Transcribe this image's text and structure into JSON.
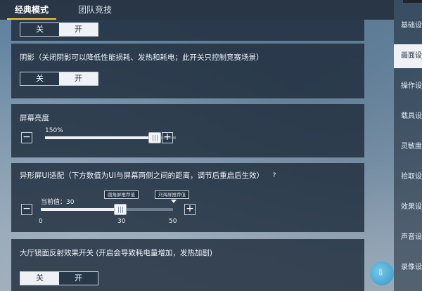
{
  "tabs": [
    "经典模式",
    "团队竞技"
  ],
  "active_tab": 0,
  "top_toggle": {
    "off": "关",
    "on": "开",
    "selected": "on"
  },
  "shadow": {
    "title": "阴影（关闭阴影可以降低性能损耗、发热和耗电；此开关只控制竞赛场景）",
    "off": "关",
    "on": "开",
    "selected": "on"
  },
  "brightness": {
    "title": "屏幕亮度",
    "value_label": "150%",
    "level": 0.84,
    "minus": "−",
    "plus": "+"
  },
  "notch": {
    "title": "异形屏UI适配（下方数值为UI与屏幕两侧之间的距离，调节后重启后生效）",
    "help": "?",
    "current_label": "当前值：30",
    "value": 30,
    "min": 0,
    "max": 50,
    "ticks": [
      "0",
      "30",
      "50"
    ],
    "marker_rounded": "圆角屏推荐值",
    "marker_notch": "刘海屏推荐值",
    "minus": "−",
    "plus": "+"
  },
  "reflection": {
    "title": "大厅镜面反射效果开关 (开启会导致耗电量增加，发热加剧)",
    "off": "关",
    "on": "开",
    "selected": "off"
  },
  "sidebar": {
    "items": [
      "基础设",
      "画面设",
      "操作设",
      "载具设",
      "灵敏度设",
      "拾取设",
      "效果设",
      "声音设",
      "录像设"
    ],
    "active": 1
  },
  "colors": {
    "accent": "#f2c94c",
    "panel": "#1e2c3c",
    "selected": "#eef2f6"
  },
  "icons": {
    "help": "question-icon",
    "minus": "minus-icon",
    "plus": "plus-icon",
    "logo": "download-logo-icon"
  }
}
